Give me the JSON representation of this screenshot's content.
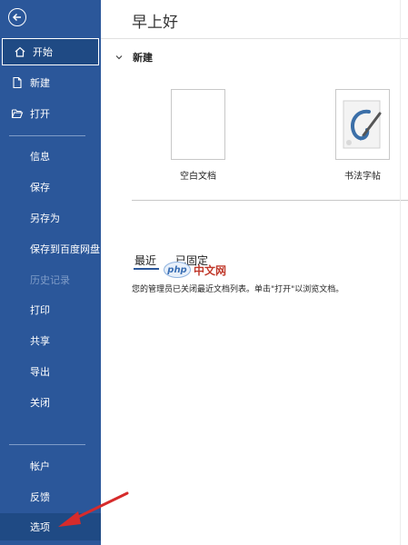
{
  "sidebar": {
    "back_icon": "back-arrow-icon",
    "primary": [
      {
        "label": "开始",
        "icon": "home-icon",
        "active": true
      },
      {
        "label": "新建",
        "icon": "new-document-icon"
      },
      {
        "label": "打开",
        "icon": "folder-open-icon"
      }
    ],
    "secondary": [
      {
        "label": "信息"
      },
      {
        "label": "保存"
      },
      {
        "label": "另存为"
      },
      {
        "label": "保存到百度网盘"
      },
      {
        "label": "历史记录",
        "disabled": true
      },
      {
        "label": "打印"
      },
      {
        "label": "共享"
      },
      {
        "label": "导出"
      },
      {
        "label": "关闭"
      }
    ],
    "bottom": [
      {
        "label": "帐户"
      },
      {
        "label": "反馈"
      },
      {
        "label": "选项"
      }
    ]
  },
  "main": {
    "greeting": "早上好",
    "new_section": {
      "title": "新建",
      "templates": [
        {
          "label": "空白文档"
        },
        {
          "label": "书法字帖"
        }
      ]
    },
    "tabs": [
      {
        "label": "最近",
        "active": true
      },
      {
        "label": "已固定"
      }
    ],
    "info_text": "您的管理员已关闭最近文档列表。单击\"打开\"以浏览文档。",
    "watermark": {
      "logo": "php",
      "text": "中文网"
    }
  },
  "colors": {
    "sidebar": "#2b579a",
    "accent": "#2b579a",
    "arrow": "#d62b2b"
  }
}
